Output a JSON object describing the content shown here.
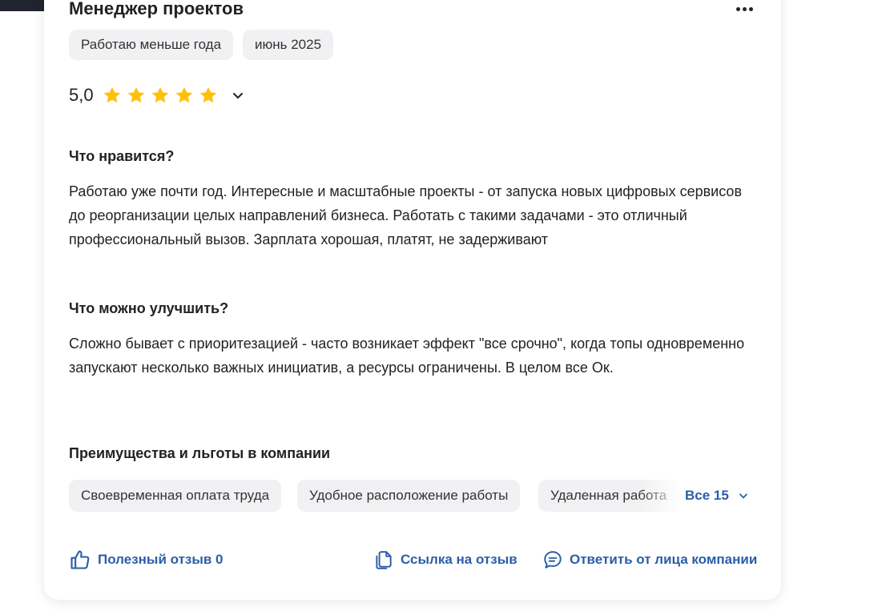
{
  "review": {
    "job_title": "Менеджер проектов",
    "tags": [
      "Работаю меньше года",
      "июнь 2025"
    ],
    "rating": "5,0",
    "stars": 5,
    "likes_title": "Что нравится?",
    "likes_text": "Работаю уже почти год. Интересные и масштабные проекты - от запуска новых цифровых сервисов до реорганизации целых направлений бизнеса. Работать с такими задачами - это отличный профессиональный вызов. Зарплата хорошая, платят, не задерживают",
    "improve_title": "Что можно улучшить?",
    "improve_text": "Сложно бывает с приоритезацией - часто возникает эффект \"все срочно\", когда топы одновременно запускают несколько важных инициатив, а ресурсы ограничены. В целом все Ок.",
    "benefits_title": "Преимущества и льготы в компании",
    "benefits": [
      "Своевременная оплата труда",
      "Удобное расположение работы",
      "Удаленная работа"
    ],
    "benefits_all_label": "Все 15"
  },
  "actions": {
    "helpful_label": "Полезный отзыв 0",
    "link_label": "Ссылка на отзыв",
    "reply_label": "Ответить от лица компании"
  },
  "icons": {
    "star_color": "#ffc107",
    "accent_color": "#2b5ea8"
  }
}
